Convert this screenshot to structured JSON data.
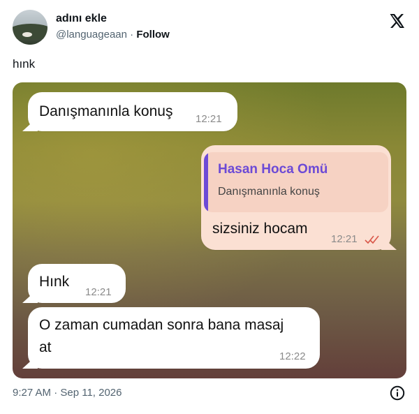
{
  "author": {
    "display_name": "adını ekle",
    "handle": "@languageaan",
    "separator": "·",
    "follow_label": "Follow"
  },
  "tweet": {
    "text": "hınk",
    "timestamp": "9:27 AM · Sep 11, 2026"
  },
  "chat": {
    "messages": [
      {
        "direction": "incoming",
        "text": "Danışmanınla konuş",
        "time": "12:21"
      },
      {
        "direction": "outgoing",
        "reply_author": "Hasan Hoca Omü",
        "reply_text": "Danışmanınla konuş",
        "text": "sizsiniz hocam",
        "time": "12:21",
        "status": "read"
      },
      {
        "direction": "incoming",
        "text": "Hınk",
        "time": "12:21"
      },
      {
        "direction": "incoming",
        "text_line1": "O zaman cumadan sonra bana masaj",
        "text_line2": "at",
        "time": "12:22"
      }
    ]
  },
  "icons": {
    "brand": "x-logo-icon",
    "read_receipt": "double-check-icon",
    "info": "info-icon"
  },
  "colors": {
    "reply_accent": "#6c4ad6",
    "read_check": "#d9584a",
    "outgoing_bubble": "#fbe0d3",
    "incoming_bubble": "#ffffff"
  }
}
